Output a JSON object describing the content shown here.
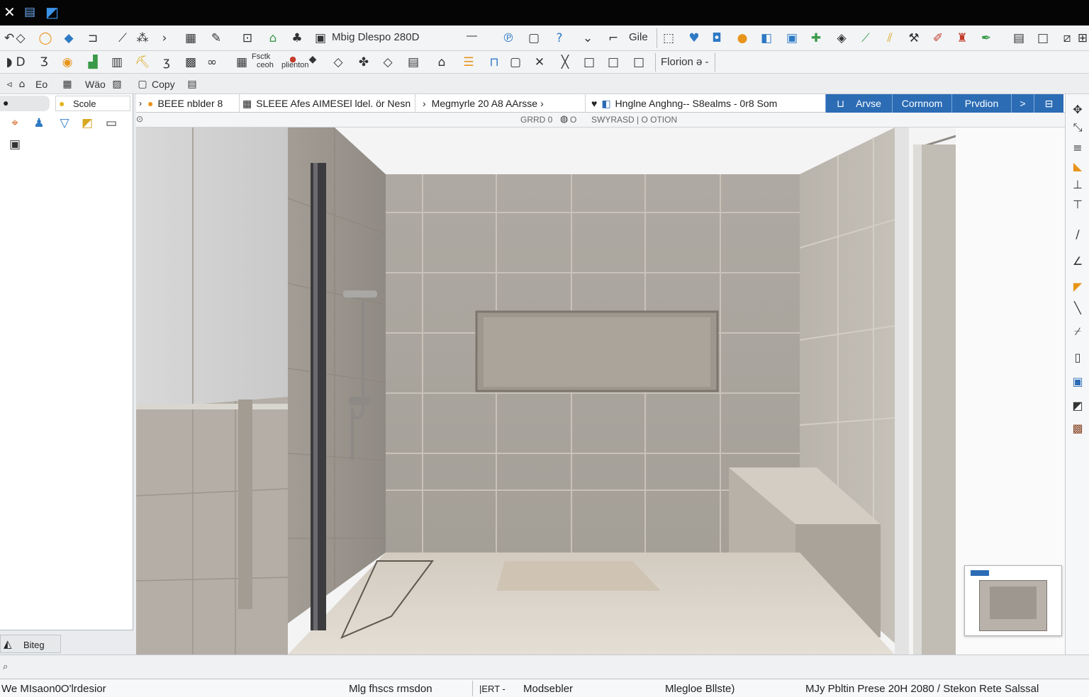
{
  "window": {
    "close_glyph": "✕",
    "icons": [
      "close-icon",
      "document-icon",
      "app-logo-icon"
    ]
  },
  "toolbar1": {
    "drawing_title": "Mbig Dlespo 280D",
    "line_label": "—",
    "grid_label": "Gile"
  },
  "toolbar2": {
    "label_a": "Fsctk",
    "label_b": "ceoh",
    "label_c": "plienton",
    "dropdown_value": "Florion ə -"
  },
  "toolbar3": {
    "label_eo": "Eo",
    "label_wao": "Wäo",
    "label_copy": "Copy"
  },
  "left_panel": {
    "scale_label": "Scole",
    "bottom_label": "Biteg"
  },
  "tabs": {
    "tab1": "BEEE nblder 8",
    "tab2": "SLEEE Afes AIMESEl ldel. ör Nesn",
    "tab3": "Megmyrle 20  A8 AArsse",
    "tab4": "Hnglne Anghng-- S8ealms - 0r8 Som",
    "blue_tab1": "Arvse",
    "blue_tab2": "Cornnom",
    "blue_tab3": "Prvdion",
    "blue_tab4": ">"
  },
  "view_strip": {
    "text_left": "GRRD 0",
    "text_mid": "O",
    "text_right": "SWYRASD | O OTION"
  },
  "status": {
    "left": "We  MIsaon0O'lrdesior",
    "mid1": "Mlg fhscs rmsdon",
    "mid2": "|ERT  -",
    "mid3": "Modsebler",
    "mid4": "Mlegloe Bllste)",
    "right": "MJy Pbltin Prese 20H 2080 / Stekon Rete Salssal"
  },
  "colors": {
    "titlebar": "#050505",
    "accent_blue": "#2b6cb5",
    "orange": "#e8941a"
  }
}
